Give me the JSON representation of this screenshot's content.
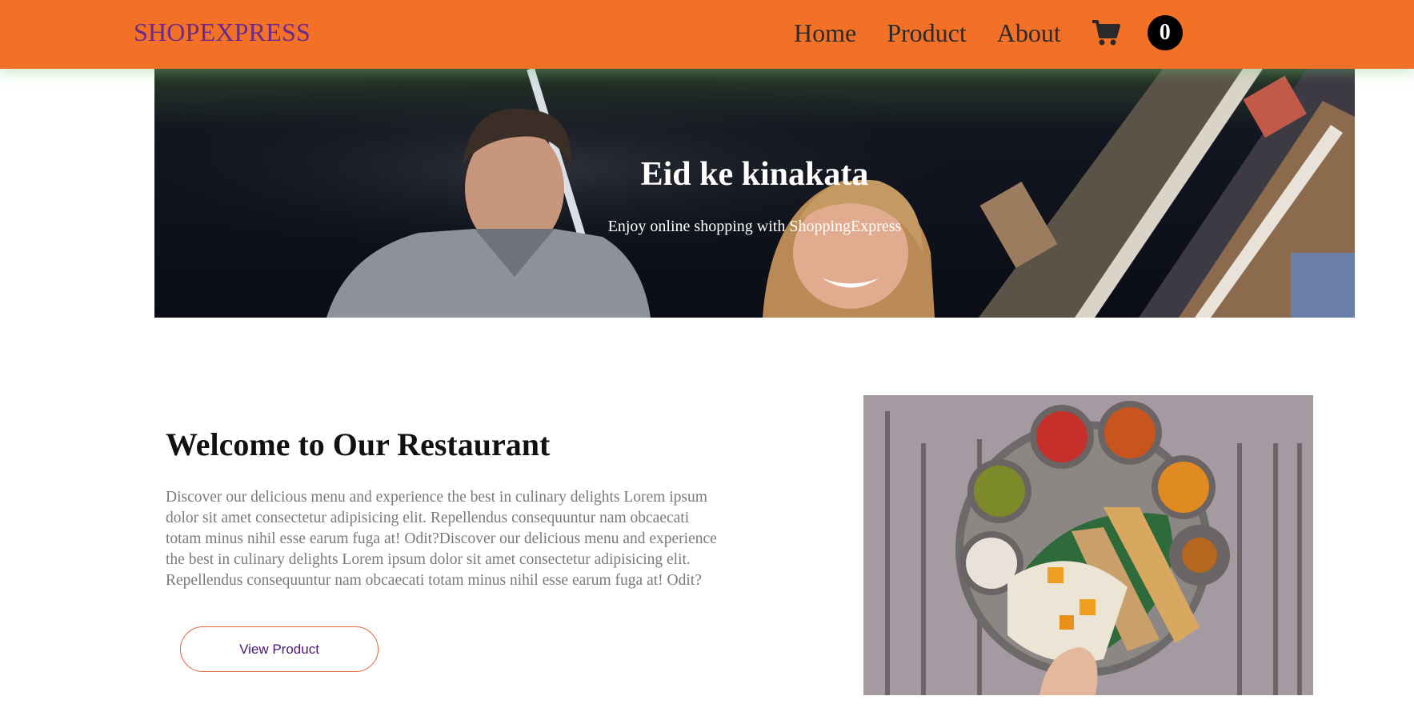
{
  "navbar": {
    "brand": "SHOPEXPRESS",
    "links": [
      "Home",
      "Product",
      "About"
    ],
    "cart_icon": "shopping-cart-icon",
    "cart_count": "0",
    "background": "#f37126",
    "brand_color": "#6a2a8c"
  },
  "hero": {
    "title": "Eid ke kinakata",
    "subtitle": "Enjoy online shopping with ShoppingExpress"
  },
  "about": {
    "title": "Welcome to Our Restaurant",
    "text": "Discover our delicious menu and experience the best in culinary delights Lorem ipsum dolor sit amet consectetur adipisicing elit. Repellendus consequuntur nam obcaecati totam minus nihil esse earum fuga at! Odit?Discover our delicious menu and experience the best in culinary delights Lorem ipsum dolor sit amet consectetur adipisicing elit. Repellendus consequuntur nam obcaecati totam minus nihil esse earum fuga at! Odit?",
    "button": "View Product",
    "button_border": "#e0643a"
  }
}
